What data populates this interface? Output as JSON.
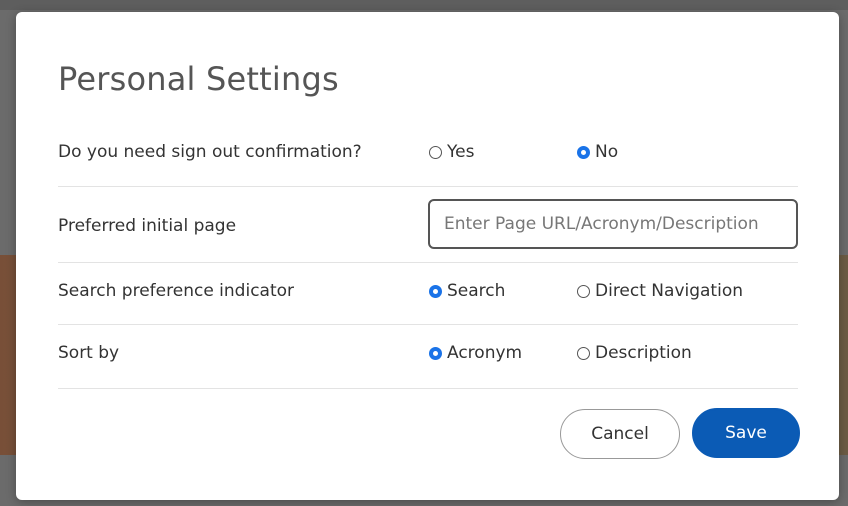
{
  "background": {
    "heading_fragment": ""
  },
  "modal": {
    "title": "Personal Settings",
    "rows": [
      {
        "label": "Do you need sign out confirmation?",
        "options": [
          {
            "label": "Yes",
            "checked": false
          },
          {
            "label": "No",
            "checked": true
          }
        ]
      },
      {
        "label": "Preferred initial page",
        "input_placeholder": "Enter Page URL/Acronym/Description",
        "input_value": ""
      },
      {
        "label": "Search preference indicator",
        "options": [
          {
            "label": "Search",
            "checked": true
          },
          {
            "label": "Direct Navigation",
            "checked": false
          }
        ]
      },
      {
        "label": "Sort by",
        "options": [
          {
            "label": "Acronym",
            "checked": true
          },
          {
            "label": "Description",
            "checked": false
          }
        ]
      }
    ],
    "buttons": {
      "cancel_label": "Cancel",
      "save_label": "Save"
    }
  },
  "colors": {
    "accent": "#1a73e8",
    "save_button": "#0b5bb5",
    "overlay": "#5a5a5a"
  }
}
